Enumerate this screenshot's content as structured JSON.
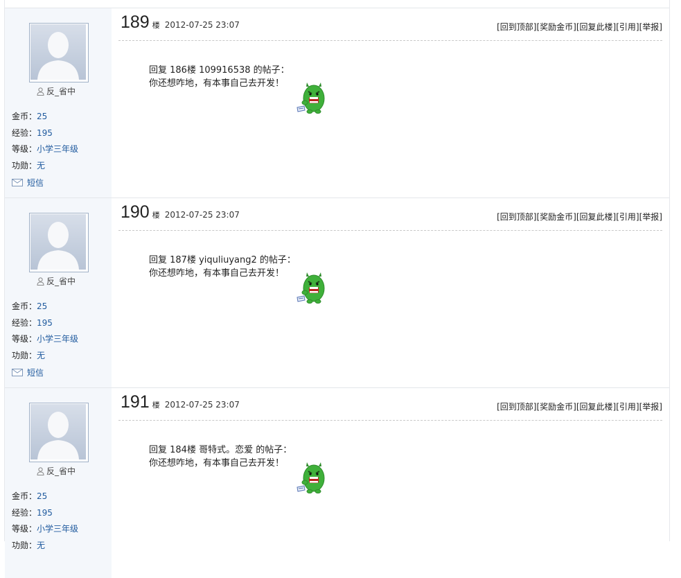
{
  "action_labels": [
    "[回到顶部]",
    "[奖励金币]",
    "[回复此楼]",
    "[引用]",
    "[举报]"
  ],
  "stat_labels": {
    "coins": "金币：",
    "exp": "经验：",
    "level": "等级：",
    "merit": "功勋：",
    "message": "短信"
  },
  "posts": [
    {
      "floor": "189",
      "floor_word": "楼",
      "date": "2012-07-25 23:07",
      "user": {
        "name": "反_省中",
        "coins": "25",
        "exp": "195",
        "level": "小学三年级",
        "merit": "无"
      },
      "reply_line": "回复  186楼  109916538 的帖子：",
      "text_line": "你还想咋地，有本事自己去开发！",
      "emoji": "angry-green-monster-emoticon"
    },
    {
      "floor": "190",
      "floor_word": "楼",
      "date": "2012-07-25 23:07",
      "user": {
        "name": "反_省中",
        "coins": "25",
        "exp": "195",
        "level": "小学三年级",
        "merit": "无"
      },
      "reply_line": "回复  187楼  yiquliuyang2 的帖子：",
      "text_line": "你还想咋地，有本事自己去开发！",
      "emoji": "angry-green-monster-emoticon"
    },
    {
      "floor": "191",
      "floor_word": "楼",
      "date": "2012-07-25 23:07",
      "user": {
        "name": "反_省中",
        "coins": "25",
        "exp": "195",
        "level": "小学三年级",
        "merit": "无"
      },
      "reply_line": "回复  184楼  哥特式。恋爱 的帖子：",
      "text_line": "你还想咋地，有本事自己去开发！",
      "emoji": "angry-green-monster-emoticon"
    }
  ],
  "colors": {
    "sidebar_bg": "#f4f7fb",
    "link": "#1f5a9e",
    "emoji_green": "#3fb03a"
  }
}
